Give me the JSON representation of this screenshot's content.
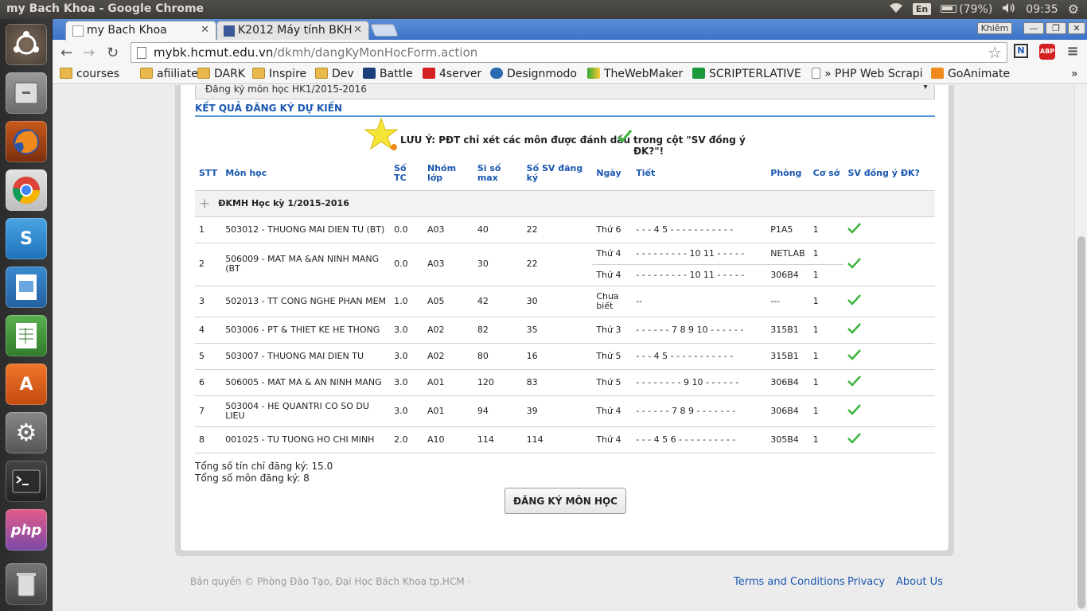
{
  "system": {
    "window_title": "my Bach Khoa - Google Chrome",
    "keyboard": "En",
    "battery": "(79%)",
    "time": "09:35"
  },
  "launcher": [
    "Ubuntu Dash",
    "Files",
    "Firefox",
    "Chromium",
    "Skype",
    "LibreOffice Impress",
    "LibreOffice Calc",
    "Ubuntu Software Center",
    "System Settings",
    "Terminal",
    "PhpStorm",
    "Trash"
  ],
  "browser": {
    "tabs": [
      {
        "label": "my Bach Khoa"
      },
      {
        "label": "K2012 Máy tính BKH"
      }
    ],
    "profile": "Khiêm",
    "url_host": "mybk.hcmut.edu.vn",
    "url_path": "/dkmh/dangKyMonHocForm.action",
    "bookmarks": [
      "courses",
      "afiiliate",
      "DARK",
      "Inspire",
      "Dev",
      "Battle",
      "4server",
      "Designmodo",
      "TheWebMaker",
      "SCRIPTERLATIVE",
      "» PHP Web Scrapi",
      "GoAnimate"
    ],
    "more_bookmarks": "»"
  },
  "page": {
    "semester_select": "Đăng ký môn học HK1/2015-2016",
    "section_title": "KẾT QUẢ ĐĂNG KÝ DỰ KIẾN",
    "note_prefix": "LƯU Ý: PĐT chỉ xét các môn được đánh dấu",
    "note_suffix": "trong cột \"SV đồng ý ĐK?\"!",
    "headers": {
      "stt": "STT",
      "mon": "Môn học",
      "tc": "Số TC",
      "nhom": "Nhóm lớp",
      "siso": "Sĩ số max",
      "sodk": "Số SV đăng ký",
      "ngay": "Ngày",
      "tiet": "Tiết",
      "phong": "Phòng",
      "coso": "Cơ sở",
      "dongy": "SV đồng ý ĐK?"
    },
    "group_label": "ĐKMH Học kỳ 1/2015-2016",
    "rows": [
      {
        "stt": "1",
        "mon": "503012 - THUONG MAI DIEN TU (BT)",
        "tc": "0.0",
        "nhom": "A03",
        "siso": "40",
        "sodk": "22",
        "ngay": "Thứ 6",
        "tiet": "- - - 4 5 - - - - - - - - - - -",
        "phong": "P1A5",
        "coso": "1"
      },
      {
        "stt": "2",
        "mon": "506009 - MAT MA &AN NINH MANG (BT",
        "tc": "0.0",
        "nhom": "A03",
        "siso": "30",
        "sodk": "22",
        "ngay": "Thứ 4",
        "tiet": "- - - - - - - - - 10 11 - - - - -",
        "phong": "NETLAB",
        "coso": "1",
        "ngay2": "Thứ 4",
        "tiet2": "- - - - - - - - - 10 11 - - - - -",
        "phong2": "306B4",
        "coso2": "1"
      },
      {
        "stt": "3",
        "mon": "502013 - TT CONG NGHE PHAN MEM",
        "tc": "1.0",
        "nhom": "A05",
        "siso": "42",
        "sodk": "30",
        "ngay": "Chưa biết",
        "tiet": "--",
        "phong": "---",
        "coso": "1"
      },
      {
        "stt": "4",
        "mon": "503006 - PT & THIET KE HE THONG",
        "tc": "3.0",
        "nhom": "A02",
        "siso": "82",
        "sodk": "35",
        "ngay": "Thứ 3",
        "tiet": "- - - - - - 7 8 9 10 - - - - - -",
        "phong": "315B1",
        "coso": "1"
      },
      {
        "stt": "5",
        "mon": "503007 - THUONG MAI DIEN TU",
        "tc": "3.0",
        "nhom": "A02",
        "siso": "80",
        "sodk": "16",
        "ngay": "Thứ 5",
        "tiet": "- - - 4 5 - - - - - - - - - - -",
        "phong": "315B1",
        "coso": "1"
      },
      {
        "stt": "6",
        "mon": "506005 - MAT MA & AN NINH MANG",
        "tc": "3.0",
        "nhom": "A01",
        "siso": "120",
        "sodk": "83",
        "ngay": "Thứ 5",
        "tiet": "- - - - - - - - 9 10 - - - - - -",
        "phong": "306B4",
        "coso": "1"
      },
      {
        "stt": "7",
        "mon": "503004 - HE QUANTRI CO SO DU LIEU",
        "tc": "3.0",
        "nhom": "A01",
        "siso": "94",
        "sodk": "39",
        "ngay": "Thứ 4",
        "tiet": "- - - - - - 7 8 9 - - - - - - -",
        "phong": "306B4",
        "coso": "1"
      },
      {
        "stt": "8",
        "mon": "001025 - TU TUONG HO CHI MINH",
        "tc": "2.0",
        "nhom": "A10",
        "siso": "114",
        "sodk": "114",
        "ngay": "Thứ 4",
        "tiet": "- - - 4 5 6 - - - - - - - - - -",
        "phong": "305B4",
        "coso": "1"
      }
    ],
    "total_credits": "Tổng số tín chỉ đăng ký: 15.0",
    "total_courses": "Tổng số môn đăng ký: 8",
    "register_button": "ĐĂNG KÝ MÔN HỌC",
    "footer_copyright": "Bản quyền © Phòng Đào Tạo, Đại Học Bách Khoa tp.HCM ·",
    "footer_links": [
      "Terms and Conditions",
      "Privacy",
      "About Us"
    ]
  },
  "colors": {
    "accent": "#1a57b0",
    "check": "#3cb43c",
    "tabstrip": "#3c73c8"
  }
}
